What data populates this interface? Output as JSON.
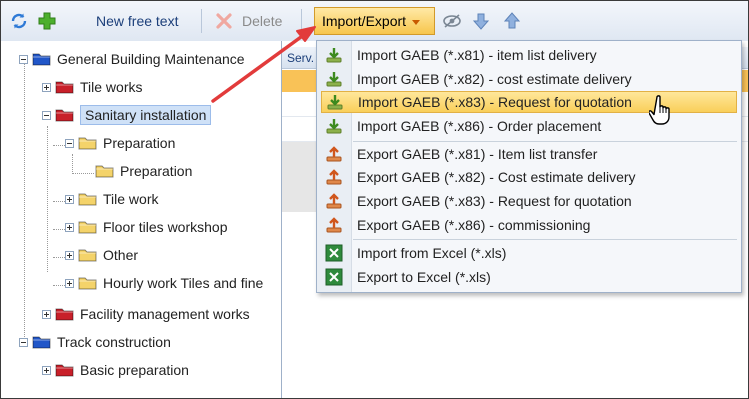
{
  "toolbar": {
    "new_free_text": "New free text",
    "delete": "Delete",
    "import_export": "Import/Export"
  },
  "colors": {
    "accent": "#f7c64c",
    "toolbar_text": "#1c3f7a",
    "folder_red": "#c8202a",
    "folder_blue": "#2156c8",
    "folder_yellow": "#f4d36a",
    "pointer_arrow": "#e23b3b"
  },
  "tree": {
    "root": "General Building Maintenance",
    "tile_works": "Tile works",
    "sanitary": "Sanitary installation",
    "preparation": "Preparation",
    "preparation_child": "Preparation",
    "tile_work": "Tile work",
    "floor_tiles": "Floor tiles workshop",
    "other": "Other",
    "hourly": "Hourly work Tiles and fine",
    "facility": "Facility management works",
    "track": "Track construction",
    "basic_prep": "Basic preparation"
  },
  "grid": {
    "header": "Serv."
  },
  "menu": {
    "items": [
      {
        "label": "Import GAEB (*.x81) - item list delivery",
        "icon": "import-green-icon"
      },
      {
        "label": "Import GAEB (*.x82) - cost estimate delivery",
        "icon": "import-green-icon"
      },
      {
        "label": "Import GAEB (*.x83) - Request for quotation",
        "icon": "import-green-icon"
      },
      {
        "label": "Import GAEB (*.x86) - Order placement",
        "icon": "import-green-icon"
      },
      {
        "label": "Export GAEB (*.x81) - Item list transfer",
        "icon": "export-orange-icon"
      },
      {
        "label": "Export GAEB (*.x82) - Cost estimate delivery",
        "icon": "export-orange-icon"
      },
      {
        "label": "Export GAEB (*.x83) - Request for quotation",
        "icon": "export-orange-icon"
      },
      {
        "label": "Export GAEB (*.x86) - commissioning",
        "icon": "export-orange-icon"
      },
      {
        "label": "Import from Excel (*.xls)",
        "icon": "excel-icon"
      },
      {
        "label": "Export to Excel (*.xls)",
        "icon": "excel-icon"
      }
    ]
  }
}
